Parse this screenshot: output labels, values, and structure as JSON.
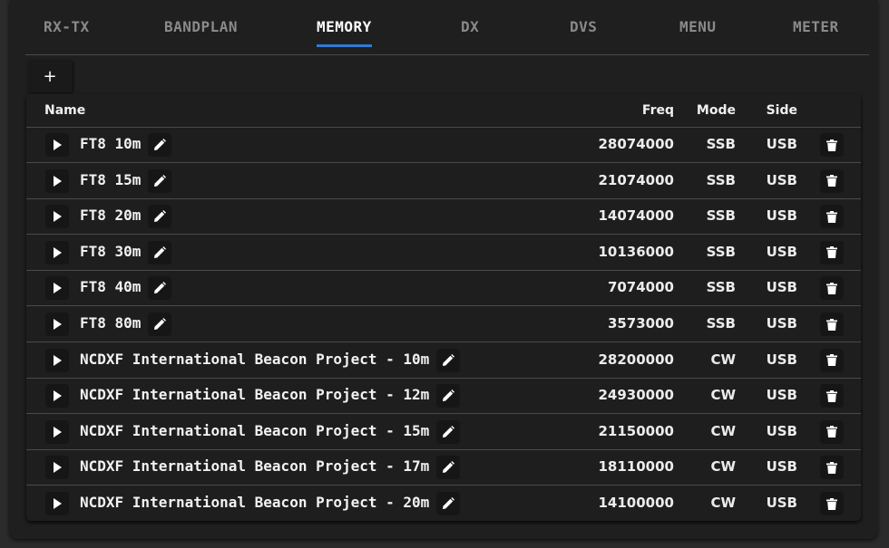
{
  "tabs": [
    {
      "label": "RX-TX"
    },
    {
      "label": "BANDPLAN"
    },
    {
      "label": "MEMORY",
      "active": true
    },
    {
      "label": "DX"
    },
    {
      "label": "DVS"
    },
    {
      "label": "MENU"
    },
    {
      "label": "METER"
    }
  ],
  "add_label": "+",
  "columns": {
    "name": "Name",
    "freq": "Freq",
    "mode": "Mode",
    "side": "Side"
  },
  "rows": [
    {
      "name": "FT8 10m",
      "freq": "28074000",
      "mode": "SSB",
      "side": "USB"
    },
    {
      "name": "FT8 15m",
      "freq": "21074000",
      "mode": "SSB",
      "side": "USB"
    },
    {
      "name": "FT8 20m",
      "freq": "14074000",
      "mode": "SSB",
      "side": "USB"
    },
    {
      "name": "FT8 30m",
      "freq": "10136000",
      "mode": "SSB",
      "side": "USB"
    },
    {
      "name": "FT8 40m",
      "freq": "7074000",
      "mode": "SSB",
      "side": "USB"
    },
    {
      "name": "FT8 80m",
      "freq": "3573000",
      "mode": "SSB",
      "side": "USB"
    },
    {
      "name": "NCDXF International Beacon Project - 10m",
      "freq": "28200000",
      "mode": "CW",
      "side": "USB"
    },
    {
      "name": "NCDXF International Beacon Project - 12m",
      "freq": "24930000",
      "mode": "CW",
      "side": "USB"
    },
    {
      "name": "NCDXF International Beacon Project - 15m",
      "freq": "21150000",
      "mode": "CW",
      "side": "USB"
    },
    {
      "name": "NCDXF International Beacon Project - 17m",
      "freq": "18110000",
      "mode": "CW",
      "side": "USB"
    },
    {
      "name": "NCDXF International Beacon Project - 20m",
      "freq": "14100000",
      "mode": "CW",
      "side": "USB"
    }
  ],
  "icons": {
    "play": "play-icon",
    "edit": "pencil-icon",
    "delete": "trash-icon",
    "add": "plus-icon"
  },
  "colors": {
    "accent": "#2e7bd6",
    "background": "#1f1f1f"
  }
}
